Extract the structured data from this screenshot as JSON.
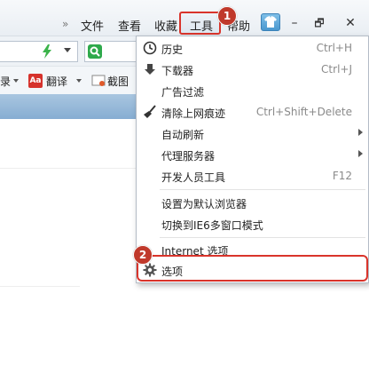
{
  "menubar": {
    "more": "»",
    "file": "文件",
    "view": "查看",
    "favorites": "收藏",
    "tools": "工具",
    "help": "帮助"
  },
  "window": {
    "minimize": "–",
    "restore": "🗗",
    "close": "✕"
  },
  "favbar": {
    "item1": "录",
    "translate": "翻译",
    "screenshot": "截图"
  },
  "menu": {
    "items": [
      {
        "label": "历史",
        "shortcut": "Ctrl+H"
      },
      {
        "label": "下载器",
        "shortcut": "Ctrl+J"
      },
      {
        "label": "广告过滤",
        "shortcut": ""
      },
      {
        "label": "清除上网痕迹",
        "shortcut": "Ctrl+Shift+Delete"
      },
      {
        "label": "自动刷新",
        "shortcut": ""
      },
      {
        "label": "代理服务器",
        "shortcut": ""
      },
      {
        "label": "开发人员工具",
        "shortcut": "F12"
      },
      {
        "label": "设置为默认浏览器",
        "shortcut": ""
      },
      {
        "label": "切换到IE6多窗口模式",
        "shortcut": ""
      },
      {
        "label": "Internet 选项",
        "shortcut": ""
      },
      {
        "label": "选项",
        "shortcut": ""
      }
    ]
  },
  "annotations": {
    "step1": "1",
    "step2": "2"
  },
  "colors": {
    "highlight": "#d9342b",
    "badge": "#c0392b",
    "tabstrip": "#86add2"
  }
}
